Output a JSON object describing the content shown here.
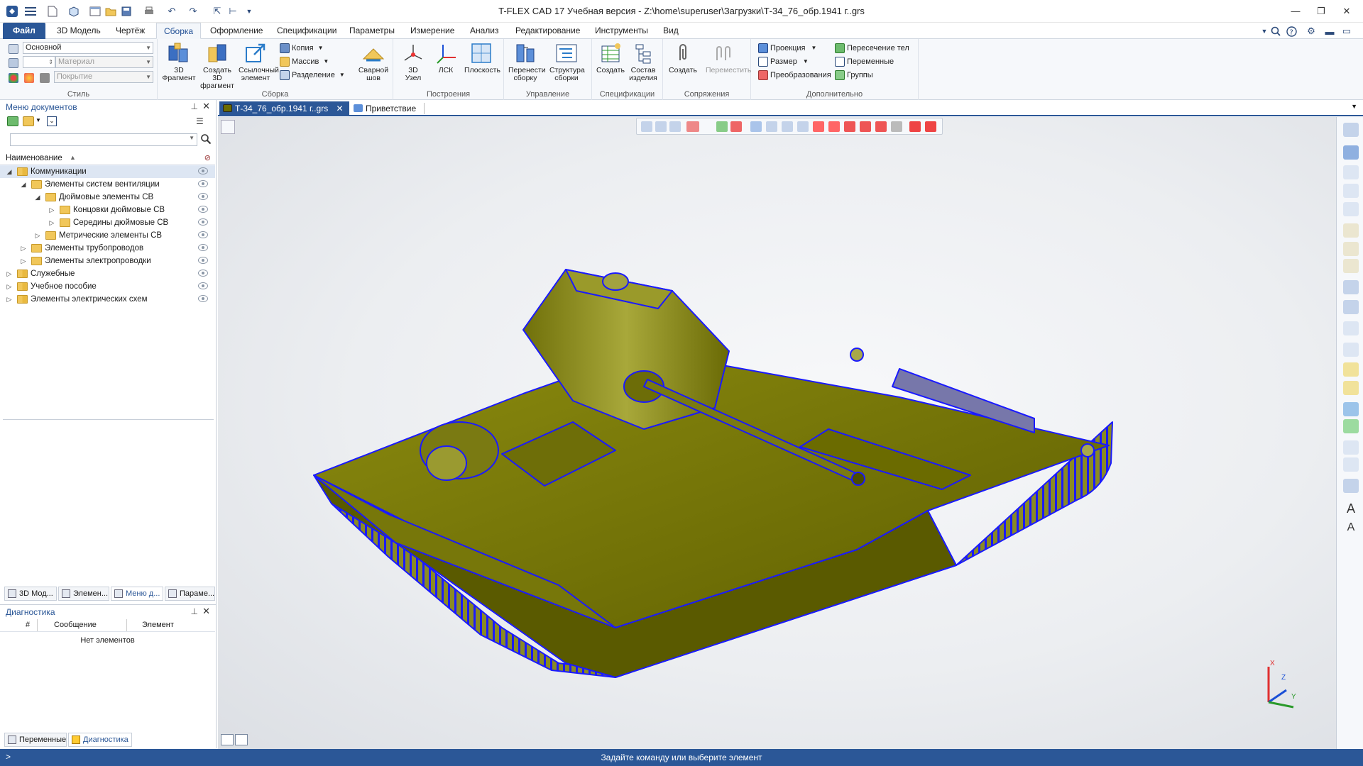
{
  "app": {
    "title": "T-FLEX CAD 17 Учебная версия - Z:\\home\\superuser\\Загрузки\\Т-34_76_обр.1941 г..grs"
  },
  "colors": {
    "accent": "#2b5797",
    "model_body": "#6b6b00",
    "model_edges": "#1a1aff",
    "status_bar": "#2b5797"
  },
  "menu_tabs": {
    "file": "Файл",
    "model3d": "3D Модель",
    "drawing": "Чертёж",
    "assembly": "Сборка",
    "formatting": "Оформление",
    "specifications": "Спецификации",
    "parameters": "Параметры",
    "measurement": "Измерение",
    "analysis": "Анализ",
    "editing": "Редактирование",
    "tools": "Инструменты",
    "view": "Вид"
  },
  "ribbon": {
    "style": {
      "label": "Стиль",
      "layer_value": "Основной",
      "material_placeholder": "Материал",
      "coating_placeholder": "Покрытие"
    },
    "assembly": {
      "label": "Сборка",
      "fragment3d": "3D\nФрагмент",
      "create_fragment": "Создать 3D\nфрагмент",
      "ref_element": "Ссылочный\nэлемент",
      "copy": "Копия",
      "array": "Массив",
      "split": "Разделение",
      "weld": "Сварной\nшов"
    },
    "constructions": {
      "label": "Построения",
      "node3d": "3D\nУзел",
      "lcs": "ЛСК",
      "plane": "Плоскость"
    },
    "management": {
      "label": "Управление",
      "rebuild": "Перенести\nсборку",
      "structure": "Структура\nсборки"
    },
    "specifications": {
      "label": "Спецификации",
      "create": "Создать",
      "composition": "Состав\nизделия"
    },
    "mates": {
      "label": "Сопряжения",
      "create": "Создать",
      "move": "Переместить"
    },
    "additional": {
      "label": "Дополнительно",
      "projection": "Проекция",
      "dimension": "Размер",
      "transform": "Преобразования",
      "intersection": "Пересечение тел",
      "variables": "Переменные",
      "groups": "Группы"
    }
  },
  "left_panel": {
    "title": "Меню документов",
    "search_placeholder": "",
    "column_header": "Наименование",
    "tree": [
      {
        "label": "Коммуникации",
        "level": 0,
        "expanded": true,
        "selected": true
      },
      {
        "label": "Элементы систем вентиляции",
        "level": 1,
        "expanded": true
      },
      {
        "label": "Дюймовые элементы СВ",
        "level": 2,
        "expanded": true
      },
      {
        "label": "Концовки дюймовые СВ",
        "level": 3,
        "expanded": false
      },
      {
        "label": "Середины дюймовые СВ",
        "level": 3,
        "expanded": false
      },
      {
        "label": "Метрические элементы СВ",
        "level": 2,
        "expanded": false
      },
      {
        "label": "Элементы трубопроводов",
        "level": 1,
        "expanded": false
      },
      {
        "label": "Элементы электропроводки",
        "level": 1,
        "expanded": false
      },
      {
        "label": "Служебные",
        "level": 0,
        "expanded": false
      },
      {
        "label": "Учебное пособие",
        "level": 0,
        "expanded": false
      },
      {
        "label": "Элементы электрических схем",
        "level": 0,
        "expanded": false
      }
    ],
    "tabs": [
      "3D Мод...",
      "Элемен...",
      "Меню д...",
      "Параме..."
    ]
  },
  "diagnostics": {
    "title": "Диагностика",
    "col_num": "#",
    "col_message": "Сообщение",
    "col_element": "Элемент",
    "empty_text": "Нет элементов",
    "tabs": [
      "Переменные",
      "Диагностика"
    ]
  },
  "documents": {
    "active_tab": "Т-34_76_обр.1941 г..grs",
    "welcome_tab": "Приветствие"
  },
  "axes": {
    "x": "X",
    "y": "Y",
    "z": "Z"
  },
  "status": {
    "prompt": ">",
    "message": "Задайте команду или выберите элемент"
  }
}
